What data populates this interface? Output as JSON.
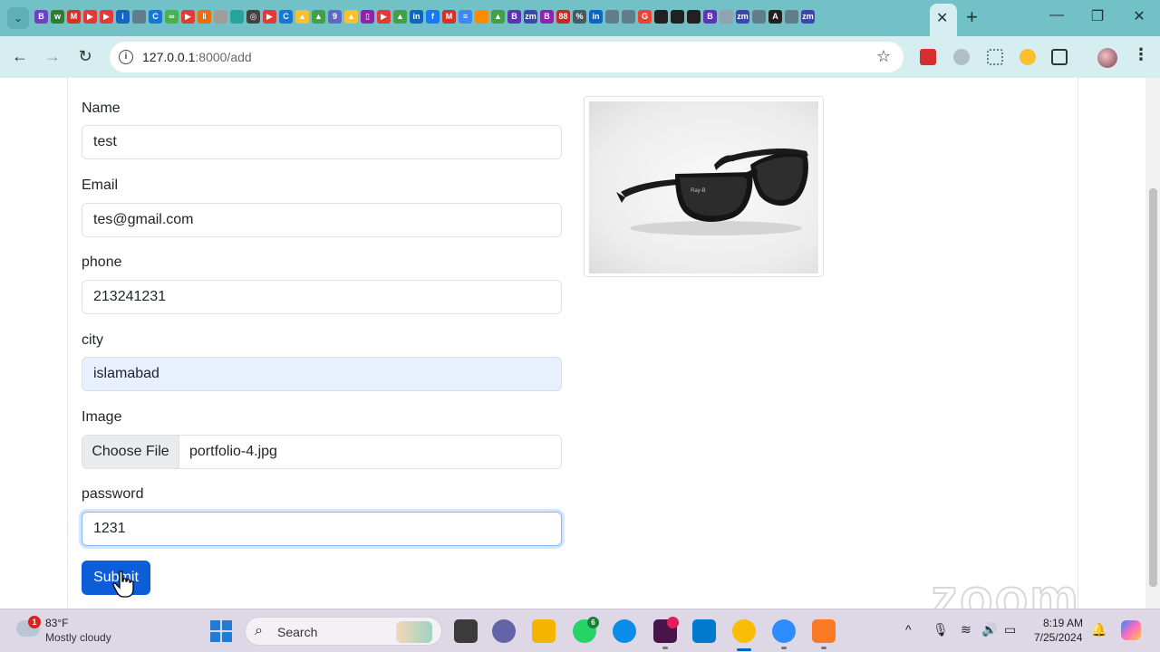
{
  "browser": {
    "url_host": "127.0.0.1",
    "url_path": ":8000/add",
    "tab_close_glyph": "✕",
    "new_tab_glyph": "+",
    "minimize_glyph": "—",
    "restore_glyph": "❐",
    "close_glyph": "✕",
    "back_glyph": "←",
    "forward_glyph": "→",
    "reload_glyph": "↻",
    "star_glyph": "☆",
    "menu_glyph": "⋮",
    "info_glyph": "i",
    "tab_search_glyph": "⌄",
    "colors": {
      "tabbar": "#72c1c7",
      "toolbar": "#d6eef0"
    }
  },
  "form": {
    "fields": [
      {
        "label": "Name",
        "value": "test"
      },
      {
        "label": "Email",
        "value": "tes@gmail.com"
      },
      {
        "label": "phone",
        "value": "213241231"
      },
      {
        "label": "city",
        "value": "islamabad"
      },
      {
        "label": "Image",
        "button": "Choose File",
        "value": "portfolio-4.jpg"
      },
      {
        "label": "password",
        "value": "1231"
      }
    ],
    "submit_label": "Submit"
  },
  "preview": {
    "icon": "sunglasses-image"
  },
  "watermark": "zoom",
  "taskbar": {
    "weather_badge": "1",
    "temperature": "83°F",
    "condition": "Mostly cloudy",
    "search_label": "Search",
    "search_glyph": "⌕",
    "whatsapp_badge": "6",
    "tray_chevron": "^",
    "mic_glyph": "🎙",
    "wifi_glyph": "≋",
    "volume_glyph": "🔊",
    "battery_glyph": "▭",
    "bell_glyph": "🔔",
    "time": "8:19 AM",
    "date": "7/25/2024"
  }
}
